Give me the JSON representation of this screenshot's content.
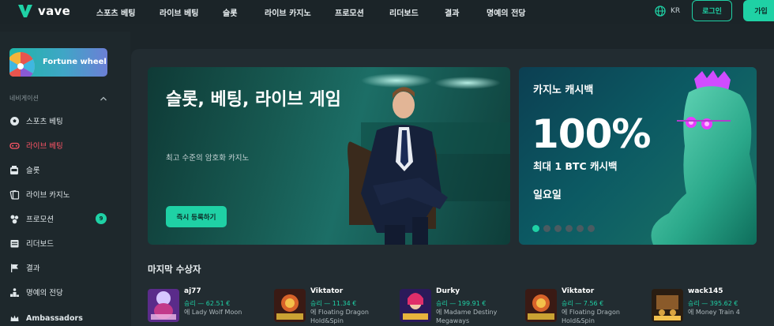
{
  "header": {
    "logo_text": "vave",
    "nav": [
      "스포츠 베팅",
      "라이브 베팅",
      "슬롯",
      "라이브 카지노",
      "프로모션",
      "리더보드",
      "결과",
      "명예의 전당"
    ],
    "lang": "KR",
    "login_label": "로그인",
    "join_label": "가입"
  },
  "sidebar": {
    "fortune_label": "Fortune wheel",
    "nav_heading": "네비게이션",
    "items": [
      {
        "label": "스포츠 베팅",
        "icon": "soccer-ball-icon"
      },
      {
        "label": "라이브 베팅",
        "icon": "gamepad-icon"
      },
      {
        "label": "슬롯",
        "icon": "slot-machine-icon"
      },
      {
        "label": "라이브 카지노",
        "icon": "cards-icon"
      },
      {
        "label": "프로모션",
        "icon": "gift-icon",
        "badge": "9"
      },
      {
        "label": "리더보드",
        "icon": "trophy-board-icon"
      },
      {
        "label": "결과",
        "icon": "flag-icon"
      },
      {
        "label": "명예의 전당",
        "icon": "podium-icon"
      },
      {
        "label": "Ambassadors",
        "icon": "crown-icon"
      }
    ]
  },
  "hero": {
    "title": "슬롯, 베팅, 라이브 게임",
    "subtitle": "최고 수준의 암호화 카지노",
    "cta_label": "즉시 등록하기"
  },
  "promo": {
    "tag": "카지노 캐시백",
    "big": "100%",
    "line": "최대 1 BTC 캐시백",
    "day": "일요일",
    "dots": 6,
    "active_dot": 0
  },
  "winners": {
    "title": "마지막 수상자",
    "items": [
      {
        "name": "aj77",
        "amount": "승리 — 62.51 €",
        "game": "에 Lady Wolf Moon"
      },
      {
        "name": "Viktator",
        "amount": "승리 — 11.34 €",
        "game": "에 Floating Dragon Hold&Spin"
      },
      {
        "name": "Durky",
        "amount": "승리 — 199.91 €",
        "game": "에 Madame Destiny Megaways"
      },
      {
        "name": "Viktator",
        "amount": "승리 — 7.56 €",
        "game": "에 Floating Dragon Hold&Spin"
      },
      {
        "name": "wack145",
        "amount": "승리 — 395.62 €",
        "game": "에 Money Train 4"
      }
    ]
  },
  "colors": {
    "accent": "#1fd1a5",
    "active_red": "#ff5566",
    "background": "#1c2529"
  }
}
